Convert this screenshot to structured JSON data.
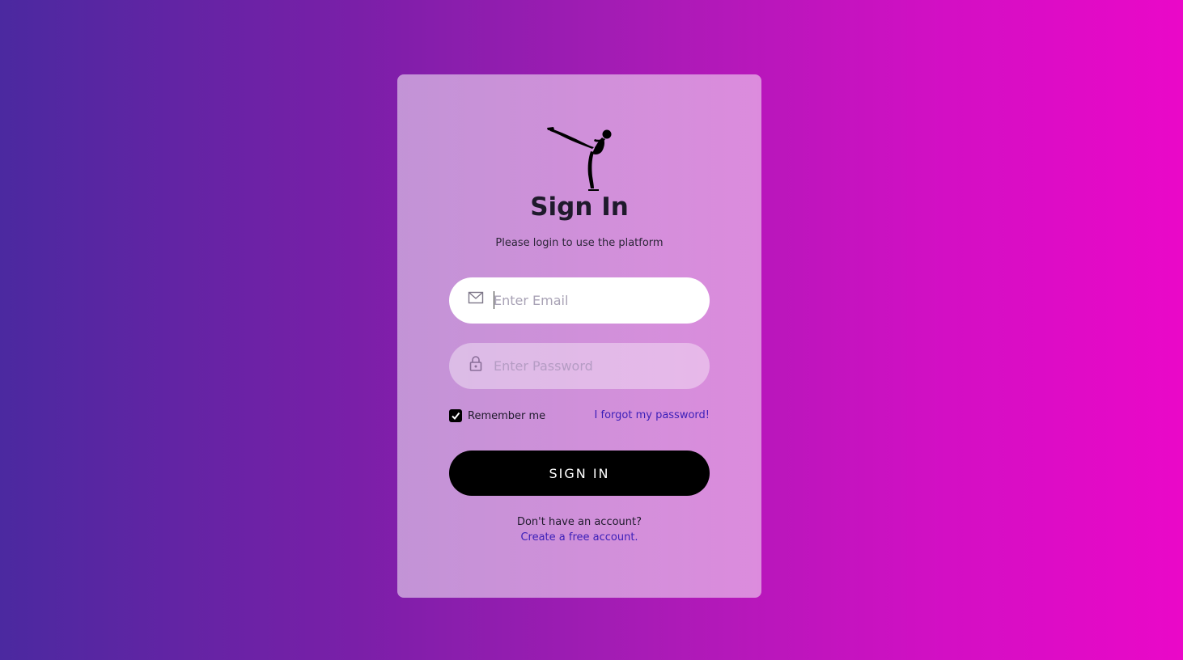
{
  "login": {
    "title": "Sign In",
    "subtitle": "Please login to use the platform",
    "email_placeholder": "Enter Email",
    "email_value": "",
    "password_placeholder": "Enter Password",
    "password_value": "",
    "remember_label": "Remember me",
    "remember_checked": true,
    "forgot_label": "I forgot my password!",
    "signin_label": "SIGN IN",
    "no_account_text": "Don't have an account?",
    "create_account_label": "Create a free account."
  },
  "icons": {
    "logo": "figure-skater-logo",
    "email": "mail-icon",
    "password": "lock-icon",
    "checkbox": "checkmark-icon"
  },
  "colors": {
    "background_start": "#4b29a0",
    "background_end": "#ea08c8",
    "link": "#3b1fb8",
    "button": "#000000"
  }
}
